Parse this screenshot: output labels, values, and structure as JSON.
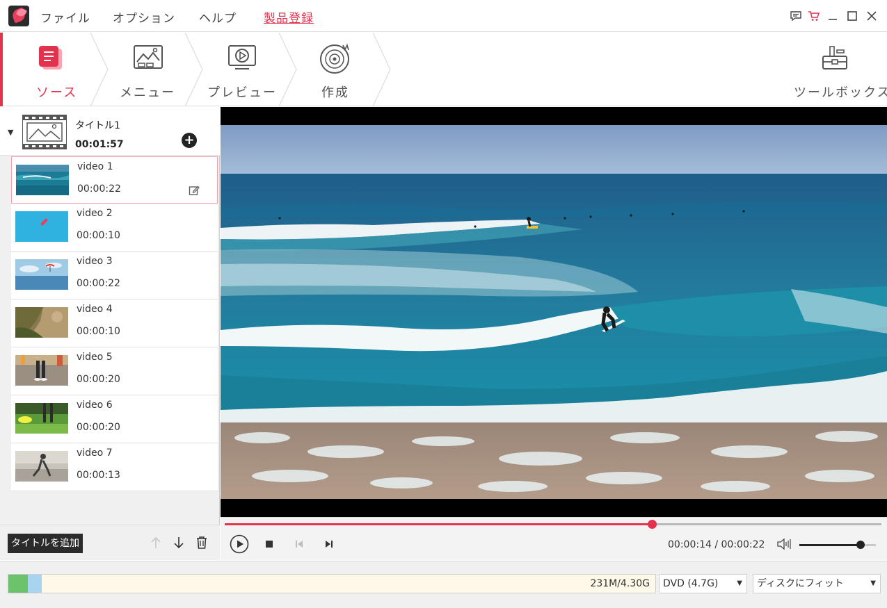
{
  "menu": {
    "file": "ファイル",
    "options": "オプション",
    "help": "ヘルプ",
    "register": "製品登録"
  },
  "window_controls": [
    "feedback-icon",
    "cart-icon",
    "minimize-icon",
    "maximize-icon",
    "close-icon"
  ],
  "steps": [
    {
      "label": "ソース",
      "icon": "source-icon",
      "active": true
    },
    {
      "label": "メニュー",
      "icon": "menu-image-icon",
      "active": false
    },
    {
      "label": "プレビュー",
      "icon": "preview-icon",
      "active": false
    },
    {
      "label": "作成",
      "icon": "burn-disc-icon",
      "active": false
    }
  ],
  "toolbox": {
    "label": "ツールボックス",
    "icon": "toolbox-icon"
  },
  "title_group": {
    "name": "タイトル1",
    "duration": "00:01:57"
  },
  "videos": [
    {
      "name": "video 1",
      "duration": "00:00:22",
      "selected": true
    },
    {
      "name": "video 2",
      "duration": "00:00:10",
      "selected": false
    },
    {
      "name": "video 3",
      "duration": "00:00:22",
      "selected": false
    },
    {
      "name": "video 4",
      "duration": "00:00:10",
      "selected": false
    },
    {
      "name": "video 5",
      "duration": "00:00:20",
      "selected": false
    },
    {
      "name": "video 6",
      "duration": "00:00:20",
      "selected": false
    },
    {
      "name": "video 7",
      "duration": "00:00:13",
      "selected": false
    }
  ],
  "left_bottom": {
    "add_title": "タイトルを追加"
  },
  "player": {
    "current_time": "00:00:14",
    "separator": " / ",
    "total_time": "00:00:22",
    "progress_fraction": 0.65,
    "volume_fraction": 0.8
  },
  "status": {
    "capacity_text": "231M/4.30G",
    "disc_type": "DVD (4.7G)",
    "fit_mode": "ディスクにフィット"
  },
  "colors": {
    "accent": "#e2324e"
  }
}
